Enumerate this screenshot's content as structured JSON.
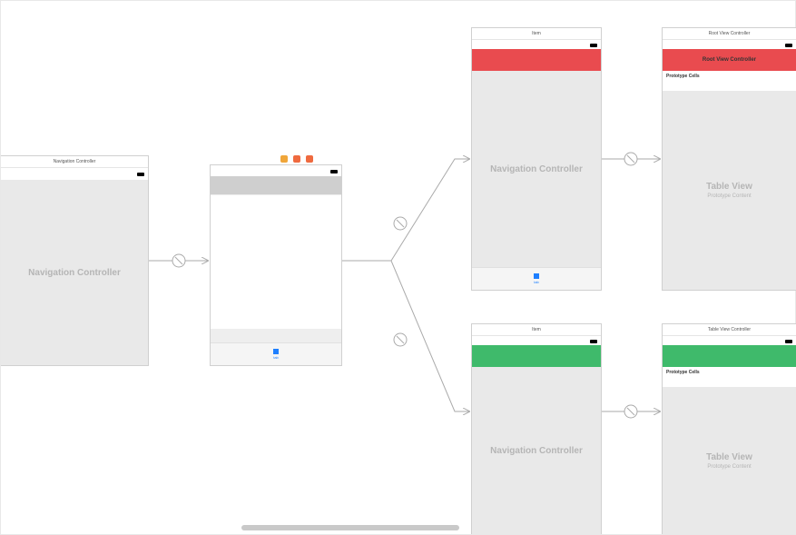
{
  "scenes": {
    "nav1": {
      "title": "Navigation Controller",
      "body_label": "Navigation Controller"
    },
    "tabvc": {
      "tab_label": "tab"
    },
    "nav_red": {
      "title": "Item",
      "body_label": "Navigation Controller"
    },
    "nav_green": {
      "title": "Item",
      "body_label": "Navigation Controller"
    },
    "root_red": {
      "title": "Root View Controller",
      "nav_title": "Root View Controller",
      "proto": "Prototype Cells",
      "tv_title": "Table View",
      "tv_sub": "Prototype Content"
    },
    "root_green": {
      "title": "Table View Controller",
      "proto": "Prototype Cells",
      "tv_title": "Table View",
      "tv_sub": "Prototype Content"
    }
  },
  "colors": {
    "red": "#e94b4f",
    "green": "#3fba6b",
    "icon_amber": "#f0a63a",
    "icon_orange": "#ef6a3f",
    "icon_blue": "#1e7fff",
    "scrollbar": "#c9c9c9"
  }
}
